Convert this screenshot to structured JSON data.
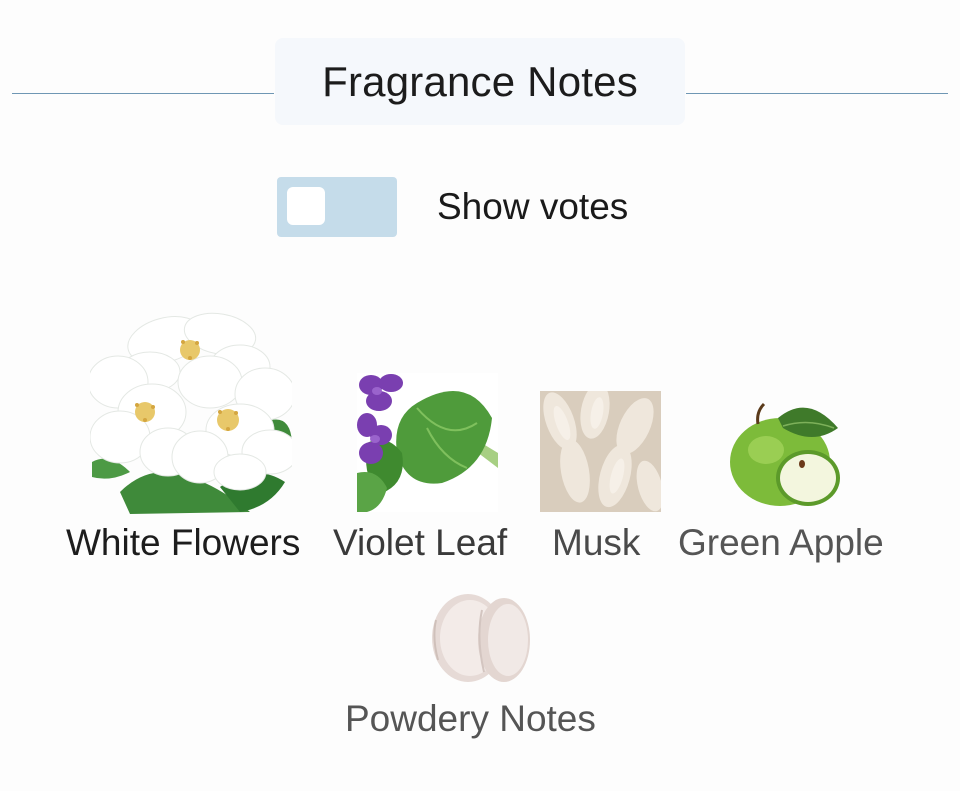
{
  "section": {
    "title": "Fragrance Notes"
  },
  "votes_toggle": {
    "label": "Show votes",
    "checked": false
  },
  "notes": [
    {
      "name": "White Flowers",
      "icon": "white-flowers-icon"
    },
    {
      "name": "Violet Leaf",
      "icon": "violet-leaf-icon"
    },
    {
      "name": "Musk",
      "icon": "musk-icon"
    },
    {
      "name": "Green Apple",
      "icon": "green-apple-icon"
    },
    {
      "name": "Powdery Notes",
      "icon": "powdery-notes-icon"
    }
  ]
}
